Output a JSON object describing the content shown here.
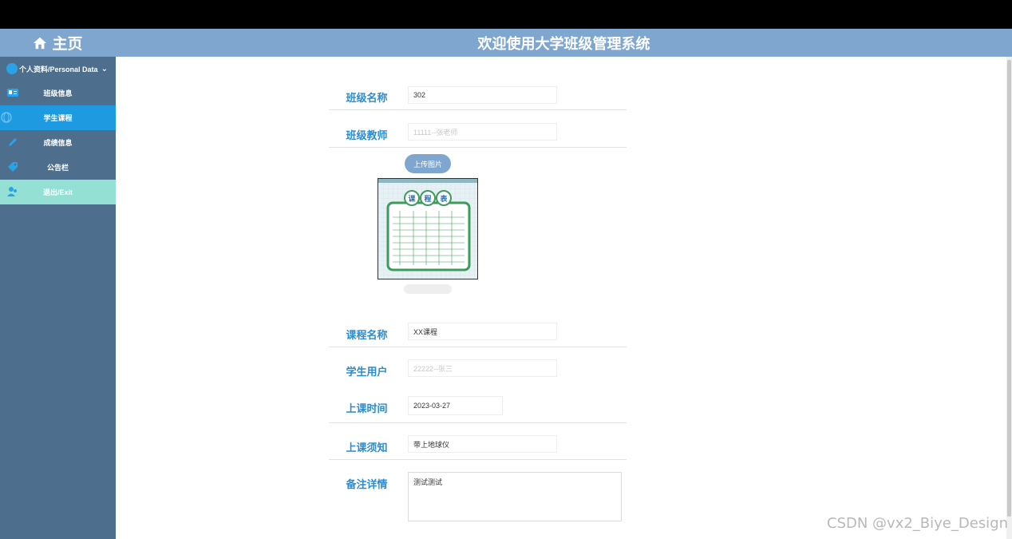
{
  "sidebar": {
    "home_label": "主页",
    "personal_label": "个人资料/Personal Data",
    "items": [
      {
        "label": "班级信息"
      },
      {
        "label": "学生课程"
      },
      {
        "label": "成绩信息"
      },
      {
        "label": "公告栏"
      },
      {
        "label": "退出/Exit"
      }
    ],
    "active_index": 1
  },
  "header": {
    "title": "欢迎使用大学班级管理系统"
  },
  "form": {
    "class_name": {
      "label": "班级名称",
      "value": "302"
    },
    "class_teacher": {
      "label": "班级教师",
      "value": "11111--张老师"
    },
    "upload_label": "上传图片",
    "image_text": "课程表",
    "course_name": {
      "label": "课程名称",
      "value": "XX课程"
    },
    "student_user": {
      "label": "学生用户",
      "value": "22222--张三"
    },
    "class_time": {
      "label": "上课时间",
      "value": "2023-03-27"
    },
    "class_notice": {
      "label": "上课须知",
      "value": "带上地球仪"
    },
    "remarks": {
      "label": "备注详情",
      "value": "测试测试"
    }
  },
  "colors": {
    "sidebar_bg": "#4e6e8e",
    "header_bg": "#7fa6cf",
    "active_item": "#1e9ae0",
    "exit_item": "#94e0d4",
    "label_blue": "#2b8ccf"
  },
  "watermark": "CSDN @vx2_Biye_Design"
}
